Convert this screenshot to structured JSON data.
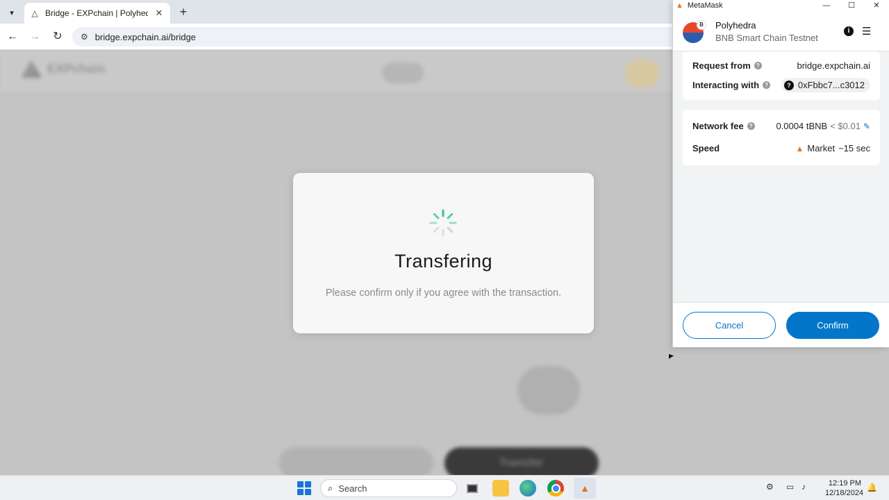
{
  "browser": {
    "tab_title": "Bridge - EXPchain | Polyhedra N",
    "url": "bridge.expchain.ai/bridge",
    "new_tab": "+",
    "tab_close": "✕"
  },
  "page": {
    "logo_text": "EXPchain",
    "transfer_button": "Transfer"
  },
  "modal": {
    "title": "Transfering",
    "subtitle": "Please confirm only if you agree with the transaction."
  },
  "metamask": {
    "window_title": "MetaMask",
    "account_name": "Polyhedra",
    "network": "BNB Smart Chain Testnet",
    "avatar_badge": "B",
    "request_from_label": "Request from",
    "request_from_value": "bridge.expchain.ai",
    "interacting_with_label": "Interacting with",
    "interacting_with_value": "0xFbbc7...c3012",
    "network_fee_label": "Network fee",
    "network_fee_value": "0.0004 tBNB",
    "network_fee_usd": "< $0.01",
    "speed_label": "Speed",
    "speed_value": "Market",
    "speed_time": "~15 sec",
    "cancel_label": "Cancel",
    "confirm_label": "Confirm",
    "accent_color": "#0376c9"
  },
  "taskbar": {
    "search_placeholder": "Search",
    "time": "12:19 PM",
    "date": "12/18/2024"
  }
}
